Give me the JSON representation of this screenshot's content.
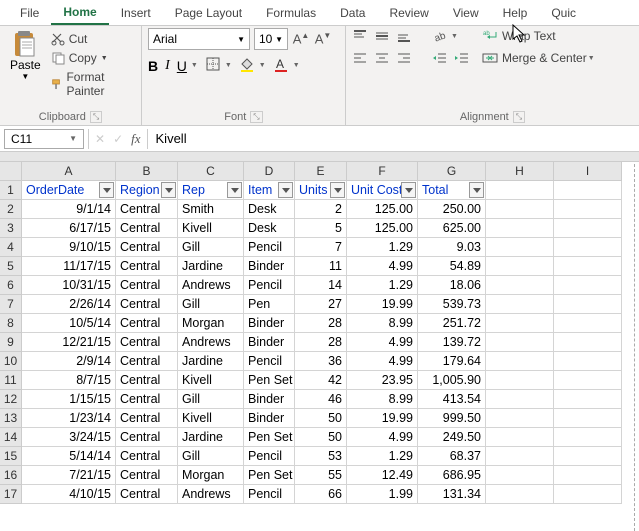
{
  "menu": {
    "items": [
      "File",
      "Home",
      "Insert",
      "Page Layout",
      "Formulas",
      "Data",
      "Review",
      "View",
      "Help",
      "Quic"
    ],
    "active": 1
  },
  "ribbon": {
    "clipboard": {
      "paste": "Paste",
      "cut": "Cut",
      "copy": "Copy",
      "format_painter": "Format Painter",
      "label": "Clipboard"
    },
    "font": {
      "name": "Arial",
      "size": "10",
      "label": "Font"
    },
    "alignment": {
      "wrap": "Wrap Text",
      "merge": "Merge & Center",
      "label": "Alignment"
    }
  },
  "formula_bar": {
    "cell": "C11",
    "value": "Kivell"
  },
  "columns": [
    "A",
    "B",
    "C",
    "D",
    "E",
    "F",
    "G",
    "H",
    "I"
  ],
  "headers": [
    "OrderDate",
    "Region",
    "Rep",
    "Item",
    "Units",
    "Unit Cost",
    "Total"
  ],
  "rows": [
    {
      "n": 2,
      "d": [
        "9/1/14",
        "Central",
        "Smith",
        "Desk",
        "2",
        "125.00",
        "250.00"
      ]
    },
    {
      "n": 3,
      "d": [
        "6/17/15",
        "Central",
        "Kivell",
        "Desk",
        "5",
        "125.00",
        "625.00"
      ]
    },
    {
      "n": 4,
      "d": [
        "9/10/15",
        "Central",
        "Gill",
        "Pencil",
        "7",
        "1.29",
        "9.03"
      ]
    },
    {
      "n": 5,
      "d": [
        "11/17/15",
        "Central",
        "Jardine",
        "Binder",
        "11",
        "4.99",
        "54.89"
      ]
    },
    {
      "n": 6,
      "d": [
        "10/31/15",
        "Central",
        "Andrews",
        "Pencil",
        "14",
        "1.29",
        "18.06"
      ]
    },
    {
      "n": 7,
      "d": [
        "2/26/14",
        "Central",
        "Gill",
        "Pen",
        "27",
        "19.99",
        "539.73"
      ]
    },
    {
      "n": 8,
      "d": [
        "10/5/14",
        "Central",
        "Morgan",
        "Binder",
        "28",
        "8.99",
        "251.72"
      ]
    },
    {
      "n": 9,
      "d": [
        "12/21/15",
        "Central",
        "Andrews",
        "Binder",
        "28",
        "4.99",
        "139.72"
      ]
    },
    {
      "n": 10,
      "d": [
        "2/9/14",
        "Central",
        "Jardine",
        "Pencil",
        "36",
        "4.99",
        "179.64"
      ]
    },
    {
      "n": 11,
      "d": [
        "8/7/15",
        "Central",
        "Kivell",
        "Pen Set",
        "42",
        "23.95",
        "1,005.90"
      ]
    },
    {
      "n": 12,
      "d": [
        "1/15/15",
        "Central",
        "Gill",
        "Binder",
        "46",
        "8.99",
        "413.54"
      ]
    },
    {
      "n": 13,
      "d": [
        "1/23/14",
        "Central",
        "Kivell",
        "Binder",
        "50",
        "19.99",
        "999.50"
      ]
    },
    {
      "n": 14,
      "d": [
        "3/24/15",
        "Central",
        "Jardine",
        "Pen Set",
        "50",
        "4.99",
        "249.50"
      ]
    },
    {
      "n": 15,
      "d": [
        "5/14/14",
        "Central",
        "Gill",
        "Pencil",
        "53",
        "1.29",
        "68.37"
      ]
    },
    {
      "n": 16,
      "d": [
        "7/21/15",
        "Central",
        "Morgan",
        "Pen Set",
        "55",
        "12.49",
        "686.95"
      ]
    },
    {
      "n": 17,
      "d": [
        "4/10/15",
        "Central",
        "Andrews",
        "Pencil",
        "66",
        "1.99",
        "131.34"
      ]
    }
  ]
}
